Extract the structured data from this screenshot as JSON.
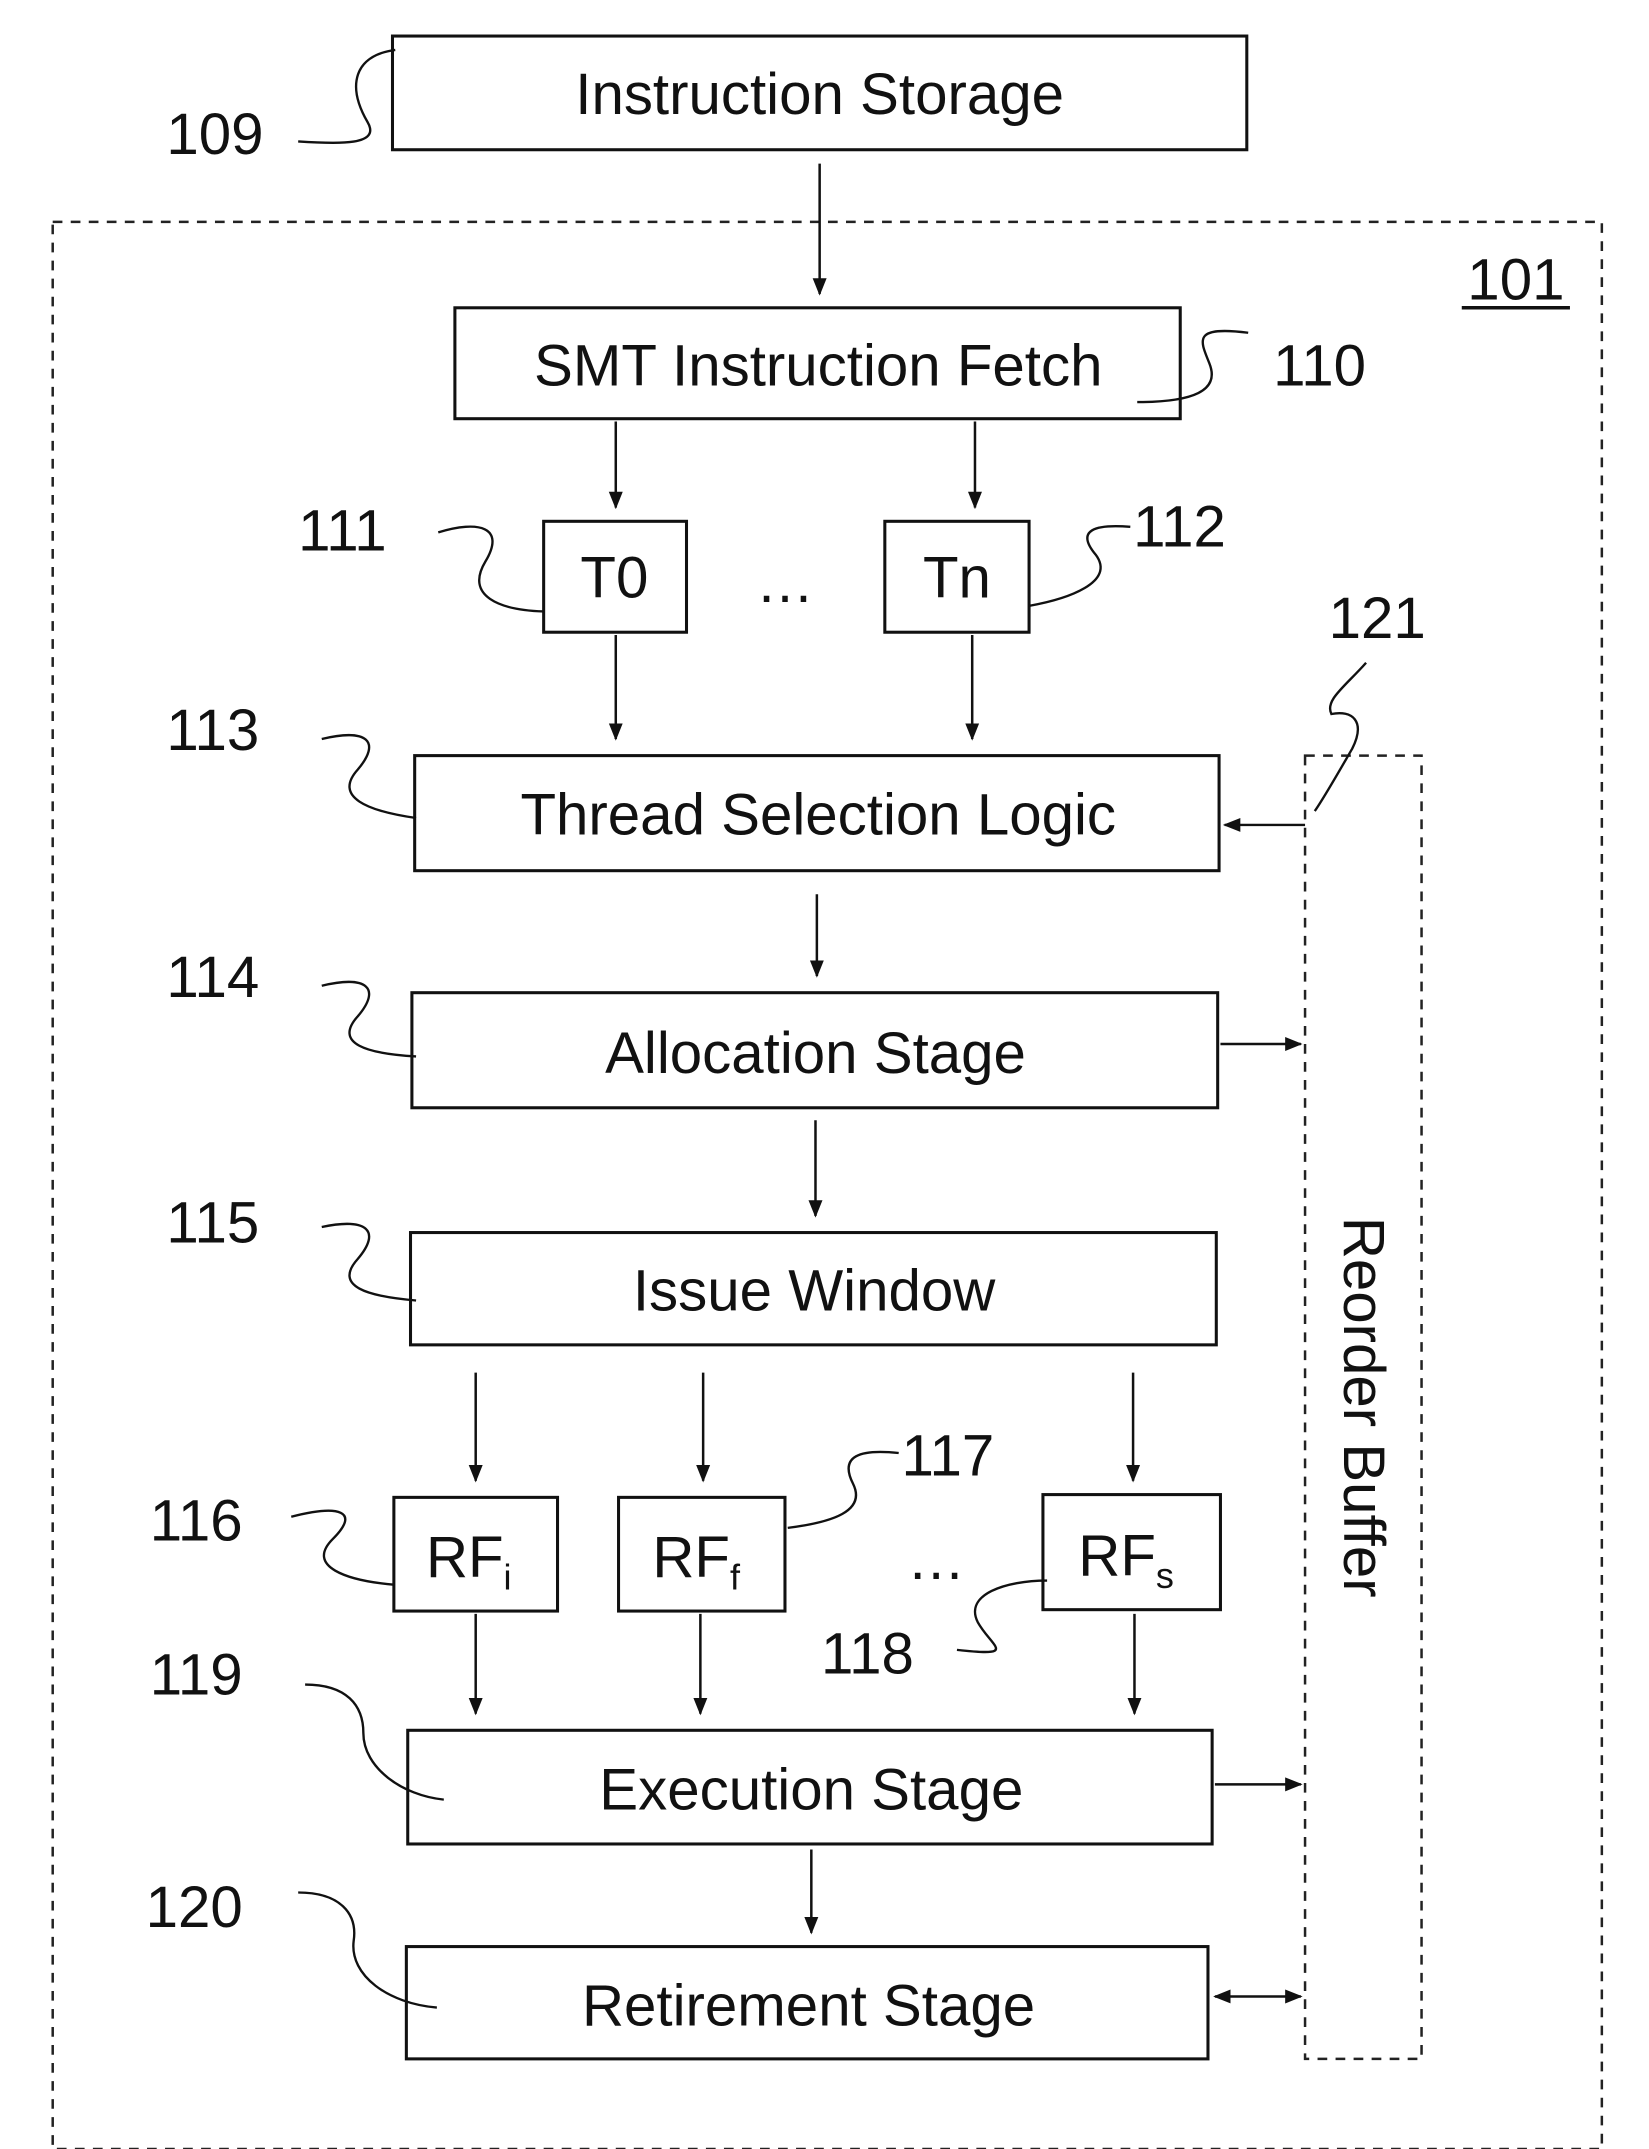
{
  "figure": {
    "container_ref": "101",
    "reorder_buffer": {
      "label": "Reorder Buffer",
      "ref": "121"
    },
    "blocks": {
      "instruction_storage": {
        "label": "Instruction Storage",
        "ref": "109"
      },
      "smt_fetch": {
        "label": "SMT Instruction Fetch",
        "ref": "110"
      },
      "t0": {
        "label": "T0",
        "ref": "111"
      },
      "tn": {
        "label": "Tn",
        "ref": "112"
      },
      "thread_selection": {
        "label": "Thread Selection Logic",
        "ref": "113"
      },
      "allocation": {
        "label": "Allocation Stage",
        "ref": "114"
      },
      "issue_window": {
        "label": "Issue Window",
        "ref": "115"
      },
      "rf_i": {
        "label": "RF",
        "sub": "i",
        "ref": "116"
      },
      "rf_f": {
        "label": "RF",
        "sub": "f",
        "ref": "117"
      },
      "rf_s": {
        "label": "RF",
        "sub": "s",
        "ref": "118"
      },
      "execution": {
        "label": "Execution Stage",
        "ref": "119"
      },
      "retirement": {
        "label": "Retirement Stage",
        "ref": "120"
      }
    },
    "ellipsis": "…"
  }
}
